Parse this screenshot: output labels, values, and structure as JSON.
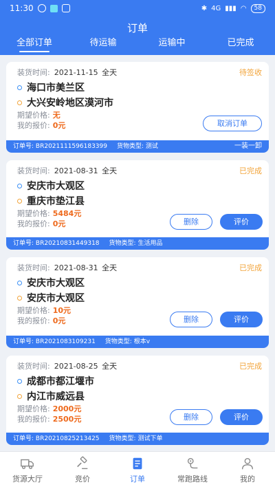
{
  "status_bar": {
    "time": "11:30",
    "network": "4G",
    "battery": "58"
  },
  "header": {
    "title": "订单"
  },
  "tabs": [
    {
      "label": "全部订单",
      "active": true
    },
    {
      "label": "待运输",
      "active": false
    },
    {
      "label": "运输中",
      "active": false
    },
    {
      "label": "已完成",
      "active": false
    }
  ],
  "labels": {
    "load_time": "装货时间:",
    "expected_price": "期望价格:",
    "my_quote": "我的报价:",
    "order_no": "订单号:",
    "goods_type": "货物类型:"
  },
  "orders": [
    {
      "date": "2021-11-15",
      "period": "全天",
      "status": "待签收",
      "from": "海口市美兰区",
      "to": "大兴安岭地区漠河市",
      "expected_price": "无",
      "my_quote": "0元",
      "buttons": [
        "取消订单"
      ],
      "order_no": "BR2021111596183399",
      "goods_type": "测试",
      "mode": "一装一卸"
    },
    {
      "date": "2021-08-31",
      "period": "全天",
      "status": "已完成",
      "from": "安庆市大观区",
      "to": "重庆市垫江县",
      "expected_price": "5484元",
      "my_quote": "0元",
      "buttons": [
        "删除",
        "评价"
      ],
      "order_no": "BR2021083144931​8",
      "goods_type": "生活用品",
      "mode": ""
    },
    {
      "date": "2021-08-31",
      "period": "全天",
      "status": "已完成",
      "from": "安庆市大观区",
      "to": "安庆市大观区",
      "expected_price": "10元",
      "my_quote": "0元",
      "buttons": [
        "删除",
        "评价"
      ],
      "order_no": "BR202108310923​1",
      "goods_type": "根本v",
      "mode": ""
    },
    {
      "date": "2021-08-25",
      "period": "全天",
      "status": "已完成",
      "from": "成都市都江堰市",
      "to": "内江市威远县",
      "expected_price": "2000元",
      "my_quote": "2500元",
      "buttons": [
        "删除",
        "评价"
      ],
      "order_no": "BR20210825213425",
      "goods_type": "测试下单",
      "mode": ""
    }
  ],
  "bottom_nav": [
    {
      "label": "货源大厅",
      "icon": "truck-icon",
      "active": false
    },
    {
      "label": "竞价",
      "icon": "gavel-icon",
      "active": false
    },
    {
      "label": "订单",
      "icon": "document-icon",
      "active": true
    },
    {
      "label": "常跑路线",
      "icon": "route-icon",
      "active": false
    },
    {
      "label": "我的",
      "icon": "person-icon",
      "active": false
    }
  ],
  "colors": {
    "primary": "#3a7bf1",
    "status": "#f2a43a",
    "price": "#ee6a1d"
  }
}
